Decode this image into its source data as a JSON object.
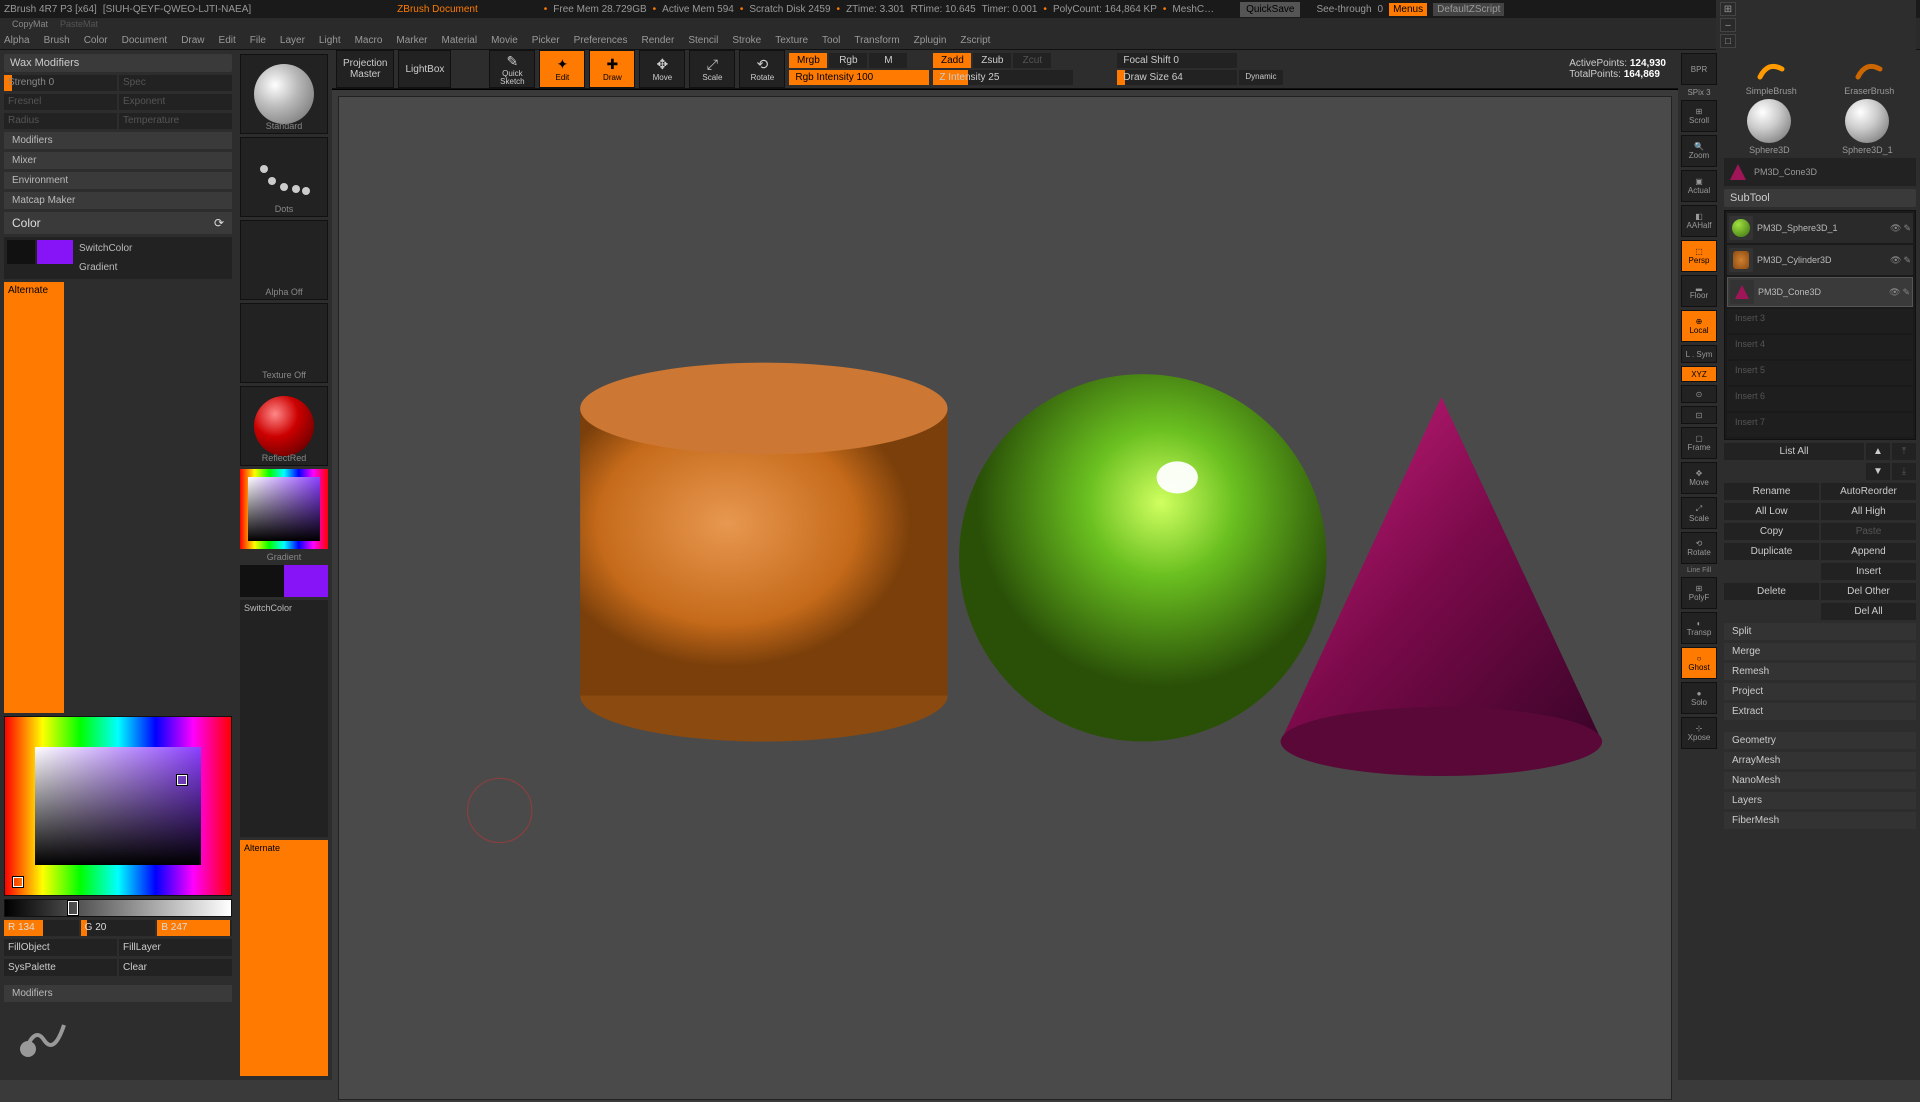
{
  "titlebar": {
    "app": "ZBrush 4R7 P3  [x64]",
    "doc": "[SIUH-QEYF-QWEO-LJTI-NAEA]",
    "title": "ZBrush Document",
    "mem": "Free Mem 28.729GB",
    "active": "Active Mem 594",
    "scratch": "Scratch Disk 2459",
    "ztime": "ZTime: 3.301",
    "rtime": "RTime: 10.645",
    "timer": "Timer: 0.001",
    "polycount": "PolyCount: 164,864 KP",
    "meshc": "MeshC…",
    "quicksave": "QuickSave",
    "seethru": "See-through",
    "seethru_val": "0",
    "menus": "Menus",
    "script": "DefaultZScript"
  },
  "subbar": {
    "copymат": "CopyMat",
    "pastemат": "PasteMat"
  },
  "menu": [
    "Alpha",
    "Brush",
    "Color",
    "Document",
    "Draw",
    "Edit",
    "File",
    "Layer",
    "Light",
    "Macro",
    "Marker",
    "Material",
    "Movie",
    "Picker",
    "Preferences",
    "Render",
    "Stencil",
    "Stroke",
    "Texture",
    "Tool",
    "Transform",
    "Zplugin",
    "Zscript"
  ],
  "left": {
    "wax": "Wax Modifiers",
    "strength": "Strength 0",
    "spec": "Spec",
    "fresnel": "Fresnel",
    "exponent": "Exponent",
    "radius": "Radius",
    "temperature": "Temperature",
    "mod": "Modifiers",
    "mixer": "Mixer",
    "env": "Environment",
    "matcap": "Matcap Maker",
    "color": "Color",
    "switch": "SwitchColor",
    "gradient": "Gradient",
    "alternate": "Alternate",
    "r": "R 134",
    "g": "G 20",
    "b": "B 247",
    "fillobj": "FillObject",
    "filllayer": "FillLayer",
    "syspal": "SysPalette",
    "clear": "Clear",
    "mod2": "Modifiers"
  },
  "toolcol": {
    "standard": "Standard",
    "dots": "Dots",
    "alpha": "Alpha Off",
    "texture": "Texture Off",
    "reflect": "ReflectRed",
    "gradient": "Gradient",
    "switch": "SwitchColor",
    "alternate": "Alternate"
  },
  "top": {
    "projection": "Projection\nMaster",
    "lightbox": "LightBox",
    "quicksketch": "Quick\nSketch",
    "edit": "Edit",
    "draw": "Draw",
    "move": "Move",
    "scale": "Scale",
    "rotate": "Rotate",
    "mrgb": "Mrgb",
    "rgb": "Rgb",
    "m": "M",
    "rgbint": "Rgb Intensity 100",
    "zadd": "Zadd",
    "zsub": "Zsub",
    "zcut": "Zcut",
    "zint": "Z Intensity 25",
    "focal": "Focal Shift 0",
    "drawsize": "Draw Size 64",
    "dynamic": "Dynamic",
    "active": "ActivePoints:",
    "active_val": "124,930",
    "total": "TotalPoints:",
    "total_val": "164,869"
  },
  "rtool": {
    "bpr": "BPR",
    "spix": "SPix 3",
    "scroll": "Scroll",
    "zoom": "Zoom",
    "actual": "Actual",
    "aahalf": "AAHalf",
    "persp": "Persp",
    "floor": "Floor",
    "local": "Local",
    "xyz": "XYZ",
    "frame": "Frame",
    "move": "Move",
    "scale": "Scale",
    "rotate": "Rotate",
    "linefill": "Line Fill",
    "polyf": "PolyF",
    "transp": "Transp",
    "ghost": "Ghost",
    "solo": "Solo",
    "xpose": "Xpose"
  },
  "right": {
    "simple": "SimpleBrush",
    "eraser": "EraserBrush",
    "sphere1": "Sphere3D",
    "sphere2": "Sphere3D_1",
    "cone": "PM3D_Cone3D",
    "subtool": "SubTool",
    "sub1": "PM3D_Sphere3D_1",
    "sub2": "PM3D_Cylinder3D",
    "sub3": "PM3D_Cone3D",
    "empty3": "Insert 3",
    "empty4": "Insert 4",
    "empty5": "Insert 5",
    "empty6": "Insert 6",
    "empty7": "Insert 7",
    "listall": "List All",
    "rename": "Rename",
    "autoreorder": "AutoReorder",
    "alllow": "All Low",
    "allhigh": "All High",
    "copy": "Copy",
    "paste": "Paste",
    "duplicate": "Duplicate",
    "append": "Append",
    "insert": "Insert",
    "delete": "Delete",
    "delother": "Del Other",
    "delall": "Del All",
    "split": "Split",
    "merge": "Merge",
    "remesh": "Remesh",
    "project": "Project",
    "extract": "Extract",
    "geometry": "Geometry",
    "arraymesh": "ArrayMesh",
    "nanomesh": "NanoMesh",
    "layers": "Layers",
    "fibermesh": "FiberMesh"
  }
}
